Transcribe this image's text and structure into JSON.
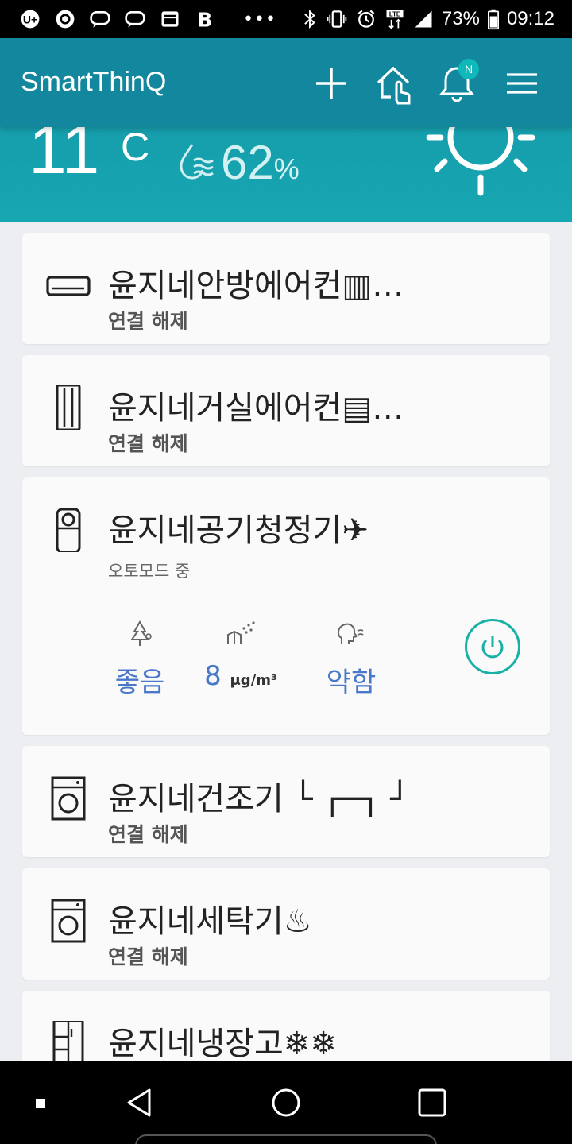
{
  "status_bar": {
    "battery": "73%",
    "time": "09:12",
    "more": "•••"
  },
  "app_bar": {
    "title": "SmartThinQ",
    "notification_badge": "N"
  },
  "weather": {
    "temperature": "11",
    "temperature_unit": "C",
    "humidity": "62",
    "humidity_unit": "%"
  },
  "devices": [
    {
      "name": "윤지네안방에어컨▥…",
      "status": "연결 해제",
      "icon": "air-conditioner-wall-icon"
    },
    {
      "name": "윤지네거실에어컨▤…",
      "status": "연결 해제",
      "icon": "air-conditioner-stand-icon"
    },
    {
      "name": "윤지네공기청정기✈",
      "status": "오토모드 중",
      "icon": "air-purifier-icon",
      "metrics": [
        {
          "icon": "tree-air-quality-icon",
          "value": "좋음"
        },
        {
          "icon": "fine-dust-icon",
          "value": "8",
          "unit": "μg/m³"
        },
        {
          "icon": "odor-face-icon",
          "value": "약함"
        }
      ]
    },
    {
      "name": "윤지네건조기 └ ┌─┐ ┘",
      "status": "연결 해제",
      "icon": "dryer-icon"
    },
    {
      "name": "윤지네세탁기♨",
      "status": "연결 해제",
      "icon": "washer-icon"
    },
    {
      "name": "윤지네냉장고❄❄",
      "status": "",
      "icon": "refrigerator-icon"
    }
  ],
  "colors": {
    "app_bar": "#13879d",
    "weather_bg": "#17a7b2",
    "accent_teal": "#19b1a6",
    "value_blue": "#4a78c8"
  }
}
